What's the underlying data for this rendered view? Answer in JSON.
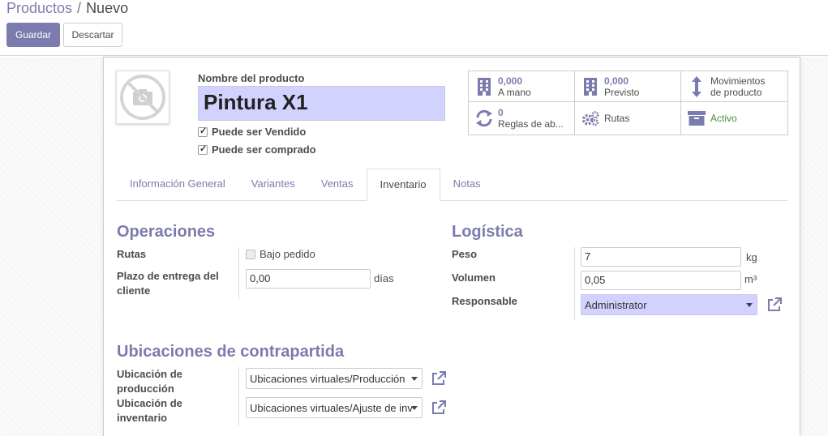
{
  "breadcrumb": {
    "parent": "Productos",
    "separator": "/",
    "current": "Nuevo"
  },
  "buttons": {
    "save": "Guardar",
    "discard": "Descartar"
  },
  "product": {
    "name_label": "Nombre del producto",
    "name": "Pintura X1",
    "can_be_sold": {
      "label": "Puede ser Vendido",
      "checked": true
    },
    "can_be_purchased": {
      "label": "Puede ser comprado",
      "checked": true
    }
  },
  "stats": [
    {
      "value": "0,000",
      "label": "A mano",
      "icon": "building-icon"
    },
    {
      "value": "0,000",
      "label": "Previsto",
      "icon": "building-icon"
    },
    {
      "value": "",
      "label": "Movimientos",
      "label2": "de producto",
      "icon": "arrows-vertical-icon"
    },
    {
      "value": "0",
      "label": "Reglas de ab...",
      "icon": "refresh-icon"
    },
    {
      "value": "",
      "label": "Rutas",
      "icon": "gears-icon"
    },
    {
      "value": "",
      "label": "Activo",
      "icon": "archive-icon"
    }
  ],
  "tabs": [
    "Información General",
    "Variantes",
    "Ventas",
    "Inventario",
    "Notas"
  ],
  "active_tab": "Inventario",
  "operations": {
    "title": "Operaciones",
    "routes_label": "Rutas",
    "routes_option": "Bajo pedido",
    "lead_time_label": "Plazo de entrega del cliente",
    "lead_time_value": "0,00",
    "lead_time_unit": "días"
  },
  "logistics": {
    "title": "Logística",
    "weight_label": "Peso",
    "weight_value": "7",
    "weight_unit": "kg",
    "volume_label": "Volumen",
    "volume_value": "0,05",
    "volume_unit": "m³",
    "responsible_label": "Responsable",
    "responsible_value": "Administrator"
  },
  "counterpart": {
    "title": "Ubicaciones de contrapartida",
    "production_label": "Ubicación de producción",
    "production_value": "Ubicaciones virtuales/Producción",
    "inventory_label": "Ubicación de inventario",
    "inventory_value": "Ubicaciones virtuales/Ajuste de inv"
  },
  "colors": {
    "primary": "#7c7bad",
    "highlight": "#d2d2ff",
    "active_status": "#4a8c3f"
  }
}
